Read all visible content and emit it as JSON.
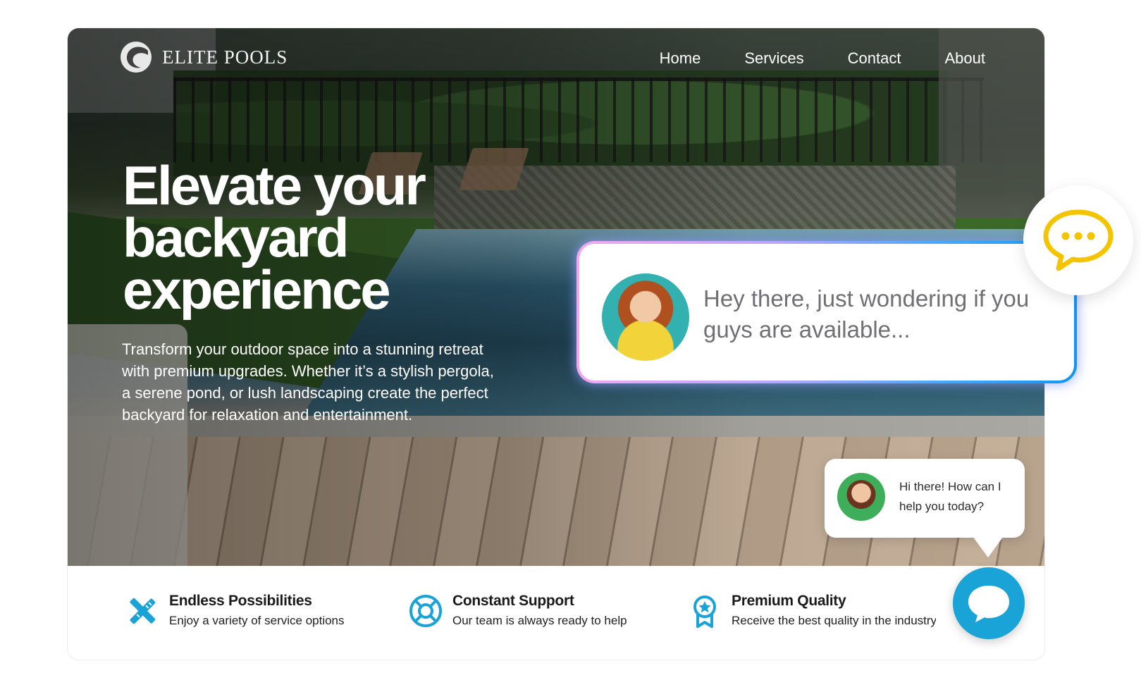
{
  "brand": {
    "name": "ELITE POOLS",
    "logo_icon": "wave-c-logo"
  },
  "nav": {
    "items": [
      {
        "label": "Home"
      },
      {
        "label": "Services"
      },
      {
        "label": "Contact"
      },
      {
        "label": "About"
      }
    ]
  },
  "hero": {
    "headline": "Elevate your backyard experience",
    "body": "Transform your outdoor space into a stunning retreat with premium upgrades. Whether it’s a stylish pergola, a serene pond, or lush landscaping create the perfect backyard for relaxation and  entertainment."
  },
  "features": [
    {
      "icon": "tools-icon",
      "title": "Endless Possibilities",
      "description": "Enjoy a variety of service options"
    },
    {
      "icon": "lifebuoy-icon",
      "title": "Constant Support",
      "description": "Our team is always ready to help"
    },
    {
      "icon": "award-badge-icon",
      "title": "Premium Quality",
      "description": "Receive the best quality in the industry"
    }
  ],
  "incoming_message": {
    "text": "Hey there, just wondering if you guys are available...",
    "avatar": "customer-avatar"
  },
  "chat_widget": {
    "greeting": "Hi there! How can I help you today?",
    "bubble_icon": "speech-bubble-dots-icon",
    "launcher_icon": "chat-icon"
  },
  "colors": {
    "accent": "#1aa3d6",
    "chat_icon_yellow": "#f5c400",
    "gradient_pink": "#f2a8f0",
    "gradient_blue": "#0f95f5",
    "message_text": "#6f6f74"
  }
}
